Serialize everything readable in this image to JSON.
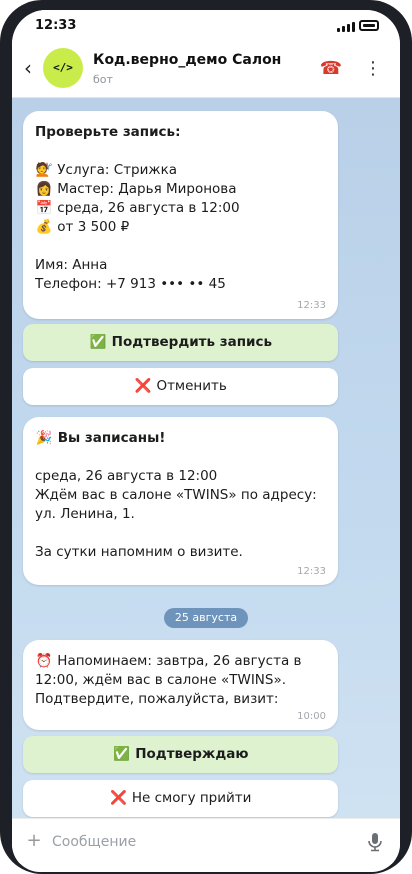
{
  "status_bar": {
    "time": "12:33"
  },
  "header": {
    "back_glyph": "‹",
    "avatar_text": "</>",
    "title": "Код.верно_демо Салон",
    "subtitle": "бот",
    "phone_glyph": "☎",
    "more_glyph": "⋮"
  },
  "messages": [
    {
      "lines": [
        {
          "emoji": "",
          "text": "Проверьте запись:"
        },
        {
          "emoji": "💇",
          "text": "Услуга: Стрижка"
        },
        {
          "emoji": "👩",
          "text": "Мастер: Дарья Миронова"
        },
        {
          "emoji": "📅",
          "text": "среда, 26 августа в 12:00"
        },
        {
          "emoji": "💰",
          "text": "от 3 500 ₽"
        },
        {
          "emoji": "",
          "text": "Имя: Анна"
        },
        {
          "emoji": "",
          "text": "Телефон: +7 913 ••• •• 45"
        }
      ],
      "time": "12:33"
    },
    {
      "lines": [
        {
          "emoji": "🎉",
          "text": "Вы записаны!"
        },
        {
          "emoji": "",
          "text": "среда, 26 августа в 12:00"
        },
        {
          "emoji": "",
          "text": "Ждём вас в салоне «TWINS» по адресу: ул. Ленина, 1."
        },
        {
          "emoji": "",
          "text": "За сутки напомним о визите."
        }
      ],
      "time": "12:33"
    },
    {
      "lines": [
        {
          "emoji": "⏰",
          "text": "Напоминаем: завтра, 26 августа в 12:00, ждём вас в салоне «TWINS». Подтвердите, пожалуйста, визит:"
        }
      ],
      "time": "10:00"
    }
  ],
  "buttons": {
    "confirm_booking": {
      "emoji": "✅",
      "label": "Подтвердить запись"
    },
    "cancel": {
      "emoji": "❌",
      "label": "Отменить"
    },
    "confirm_visit": {
      "emoji": "✅",
      "label": "Подтверждаю"
    },
    "cant_come": {
      "emoji": "❌",
      "label": "Не смогу прийти"
    }
  },
  "date_separator": "25 августа",
  "composer": {
    "placeholder": "Сообщение",
    "plus_glyph": "+"
  },
  "colors": {
    "accent_avatar": "#c9ec4a",
    "confirm_button_bg": "#def2cf",
    "date_pill_bg": "#6e94bb",
    "chat_bg": "#bfd6ec"
  }
}
